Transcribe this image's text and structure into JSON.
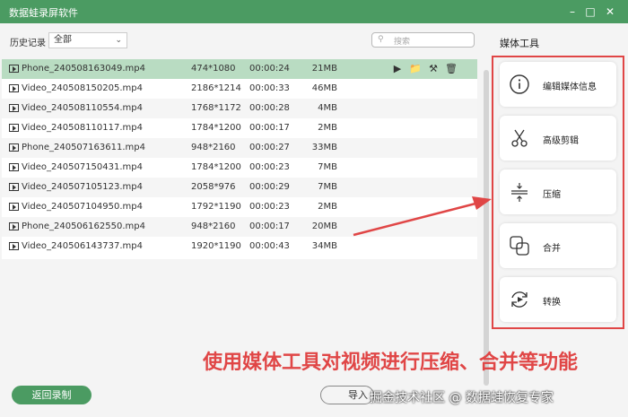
{
  "window": {
    "title": "数据蛙录屏软件",
    "controls": [
      "minimize-icon",
      "maximize-icon",
      "close-icon"
    ]
  },
  "toolbar": {
    "history_label": "历史记录",
    "filter_value": "全部",
    "search_placeholder": "搜索"
  },
  "recordings": [
    {
      "name": "Phone_240508163049.mp4",
      "resolution": "474*1080",
      "duration": "00:00:24",
      "size": "21MB",
      "selected": true
    },
    {
      "name": "Video_240508150205.mp4",
      "resolution": "2186*1214",
      "duration": "00:00:33",
      "size": "46MB"
    },
    {
      "name": "Video_240508110554.mp4",
      "resolution": "1768*1172",
      "duration": "00:00:28",
      "size": "4MB"
    },
    {
      "name": "Video_240508110117.mp4",
      "resolution": "1784*1200",
      "duration": "00:00:17",
      "size": "2MB"
    },
    {
      "name": "Phone_240507163611.mp4",
      "resolution": "948*2160",
      "duration": "00:00:27",
      "size": "33MB"
    },
    {
      "name": "Video_240507150431.mp4",
      "resolution": "1784*1200",
      "duration": "00:00:23",
      "size": "7MB"
    },
    {
      "name": "Video_240507105123.mp4",
      "resolution": "2058*976",
      "duration": "00:00:29",
      "size": "7MB"
    },
    {
      "name": "Video_240507104950.mp4",
      "resolution": "1792*1190",
      "duration": "00:00:23",
      "size": "2MB"
    },
    {
      "name": "Phone_240506162550.mp4",
      "resolution": "948*2160",
      "duration": "00:00:17",
      "size": "20MB"
    },
    {
      "name": "Video_240506143737.mp4",
      "resolution": "1920*1190",
      "duration": "00:00:43",
      "size": "34MB"
    }
  ],
  "row_actions": [
    "play-icon",
    "folder-icon",
    "edit-tool-icon",
    "trash-icon"
  ],
  "media_tools": {
    "title": "媒体工具",
    "items": [
      {
        "label": "编辑媒体信息",
        "icon": "info-icon"
      },
      {
        "label": "高级剪辑",
        "icon": "scissors-icon"
      },
      {
        "label": "压缩",
        "icon": "compress-icon"
      },
      {
        "label": "合并",
        "icon": "merge-icon"
      },
      {
        "label": "转换",
        "icon": "convert-icon"
      }
    ]
  },
  "footer": {
    "back_label": "返回录制",
    "import_label": "导入"
  },
  "annotation": {
    "text": "使用媒体工具对视频进行压缩、合并等功能",
    "color": "#e04646"
  },
  "watermark": "掘金技术社区 @ 数据蛙恢复专家",
  "colors": {
    "accent": "#4b9b62",
    "selected_row": "#b9dcc2",
    "annotation": "#e04646"
  }
}
